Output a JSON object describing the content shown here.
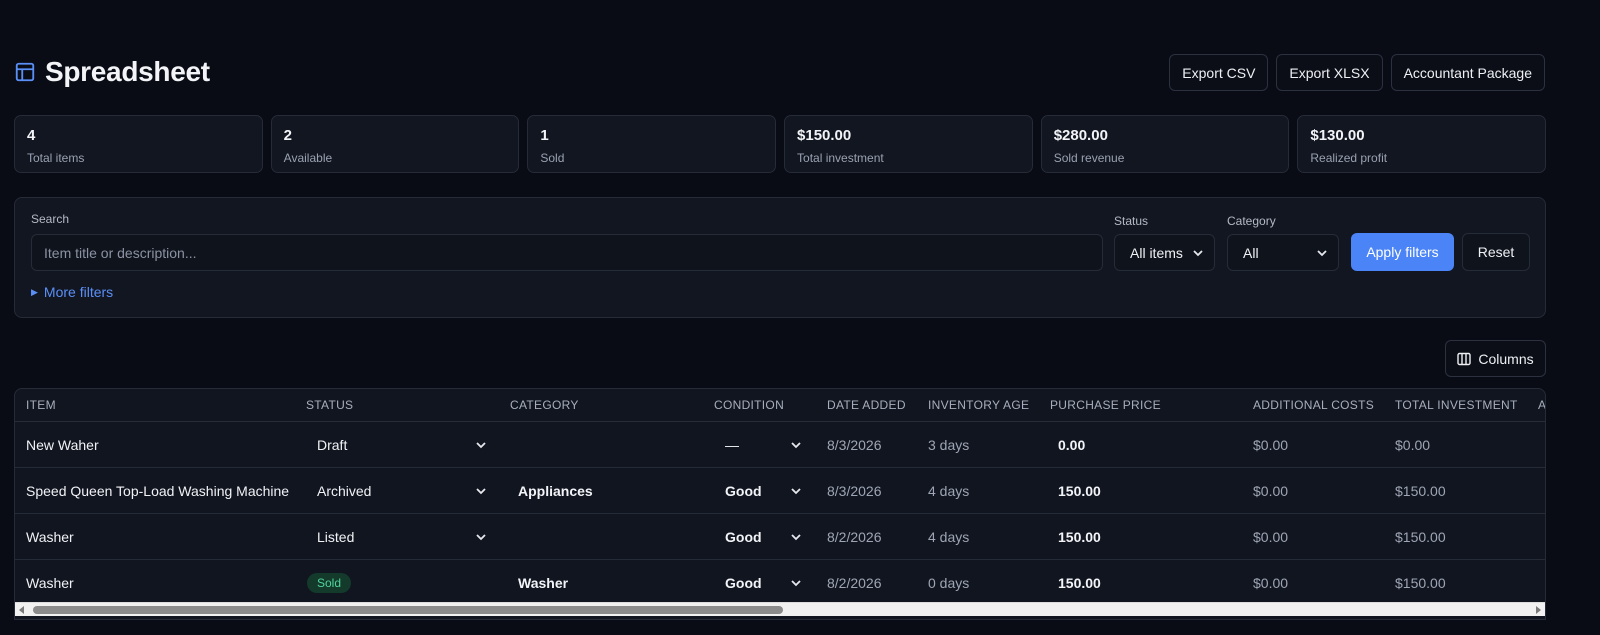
{
  "header": {
    "title": "Spreadsheet",
    "icon": "table-icon",
    "actions": [
      "Export CSV",
      "Export XLSX",
      "Accountant Package"
    ]
  },
  "stats": [
    {
      "value": "4",
      "label": "Total items"
    },
    {
      "value": "2",
      "label": "Available"
    },
    {
      "value": "1",
      "label": "Sold"
    },
    {
      "value": "$150.00",
      "label": "Total investment"
    },
    {
      "value": "$280.00",
      "label": "Sold revenue"
    },
    {
      "value": "$130.00",
      "label": "Realized profit"
    }
  ],
  "filters": {
    "search_label": "Search",
    "search_placeholder": "Item title or description...",
    "search_value": "",
    "status_label": "Status",
    "status_value": "All items",
    "category_label": "Category",
    "category_value": "All",
    "apply_label": "Apply filters",
    "reset_label": "Reset",
    "more_label": "More filters"
  },
  "columns_button": "Columns",
  "table": {
    "headers": [
      "ITEM",
      "STATUS",
      "CATEGORY",
      "CONDITION",
      "DATE ADDED",
      "INVENTORY AGE",
      "PURCHASE PRICE",
      "ADDITIONAL COSTS",
      "TOTAL INVESTMENT",
      "A"
    ],
    "rows": [
      {
        "item": "New Waher",
        "status": "Draft",
        "category": "",
        "condition": "—",
        "date_added": "8/3/2026",
        "age": "3 days",
        "purchase": "0.00",
        "additional": "$0.00",
        "total": "$0.00"
      },
      {
        "item": "Speed Queen Top-Load Washing Machine",
        "status": "Archived",
        "category": "Appliances",
        "condition": "Good",
        "date_added": "8/3/2026",
        "age": "4 days",
        "purchase": "150.00",
        "additional": "$0.00",
        "total": "$150.00"
      },
      {
        "item": "Washer",
        "status": "Listed",
        "category": "",
        "condition": "Good",
        "date_added": "8/2/2026",
        "age": "4 days",
        "purchase": "150.00",
        "additional": "$0.00",
        "total": "$150.00"
      },
      {
        "item": "Washer",
        "status": "Sold",
        "category": "Washer",
        "condition": "Good",
        "date_added": "8/2/2026",
        "age": "0 days",
        "purchase": "150.00",
        "additional": "$0.00",
        "total": "$150.00"
      }
    ]
  },
  "colors": {
    "background": "#090c14",
    "card": "#121620",
    "accent": "#4b84f7",
    "sold_badge_bg": "#143a2c",
    "sold_badge_text": "#4fd49b"
  }
}
